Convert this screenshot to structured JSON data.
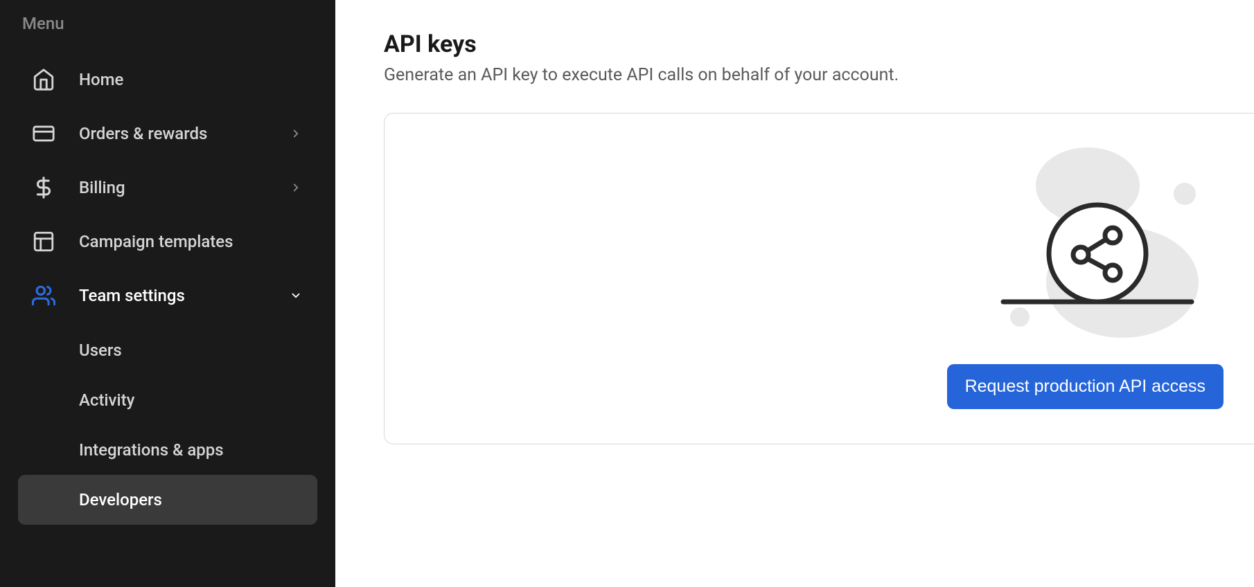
{
  "sidebar": {
    "menu_label": "Menu",
    "items": [
      {
        "label": "Home",
        "icon": "home"
      },
      {
        "label": "Orders & rewards",
        "icon": "card",
        "chevron": "right"
      },
      {
        "label": "Billing",
        "icon": "dollar",
        "chevron": "right"
      },
      {
        "label": "Campaign templates",
        "icon": "layout"
      },
      {
        "label": "Team settings",
        "icon": "users",
        "chevron": "down",
        "active_icon": true,
        "expanded": true
      }
    ],
    "sub_items": [
      {
        "label": "Users"
      },
      {
        "label": "Activity"
      },
      {
        "label": "Integrations & apps"
      },
      {
        "label": "Developers",
        "active": true
      }
    ]
  },
  "main": {
    "title": "API keys",
    "subtitle": "Generate an API key to execute API calls on behalf of your account.",
    "request_button": "Request production API access"
  }
}
